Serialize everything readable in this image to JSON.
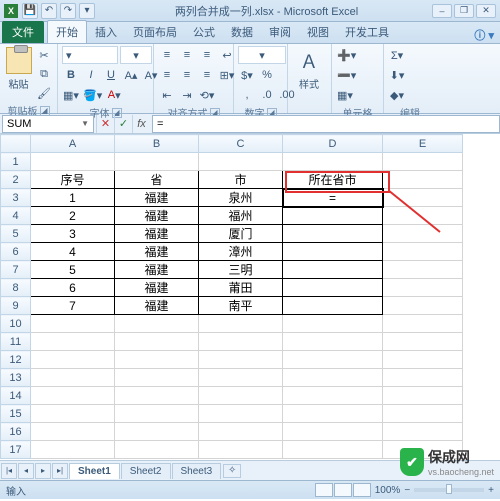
{
  "title": "两列合并成一列.xlsx - Microsoft Excel",
  "ribbon_tabs": {
    "file": "文件",
    "home": "开始",
    "insert": "插入",
    "layout": "页面布局",
    "formulas": "公式",
    "data": "数据",
    "review": "审阅",
    "view": "视图",
    "developer": "开发工具"
  },
  "ribbon_groups": {
    "clipboard": "剪贴板",
    "font": "字体",
    "align": "对齐方式",
    "number": "数字",
    "cells": "单元格",
    "editing": "编辑"
  },
  "paste_label": "粘贴",
  "namebox": "SUM",
  "formula": "=",
  "columns": [
    "A",
    "B",
    "C",
    "D",
    "E"
  ],
  "rows": [
    "1",
    "2",
    "3",
    "4",
    "5",
    "6",
    "7",
    "8",
    "9",
    "10",
    "11",
    "12",
    "13",
    "14",
    "15",
    "16",
    "17"
  ],
  "headers": {
    "a": "序号",
    "b": "省",
    "c": "市",
    "d": "所在省市"
  },
  "data_rows": [
    {
      "n": "1",
      "p": "福建",
      "c": "泉州"
    },
    {
      "n": "2",
      "p": "福建",
      "c": "福州"
    },
    {
      "n": "3",
      "p": "福建",
      "c": "厦门"
    },
    {
      "n": "4",
      "p": "福建",
      "c": "漳州"
    },
    {
      "n": "5",
      "p": "福建",
      "c": "三明"
    },
    {
      "n": "6",
      "p": "福建",
      "c": "莆田"
    },
    {
      "n": "7",
      "p": "福建",
      "c": "南平"
    }
  ],
  "active_cell_value": "=",
  "sheet_tabs": {
    "s1": "Sheet1",
    "s2": "Sheet2",
    "s3": "Sheet3"
  },
  "status": "输入",
  "zoom": "100%",
  "watermark": {
    "name": "保成网",
    "url": "vs.baocheng.net"
  }
}
